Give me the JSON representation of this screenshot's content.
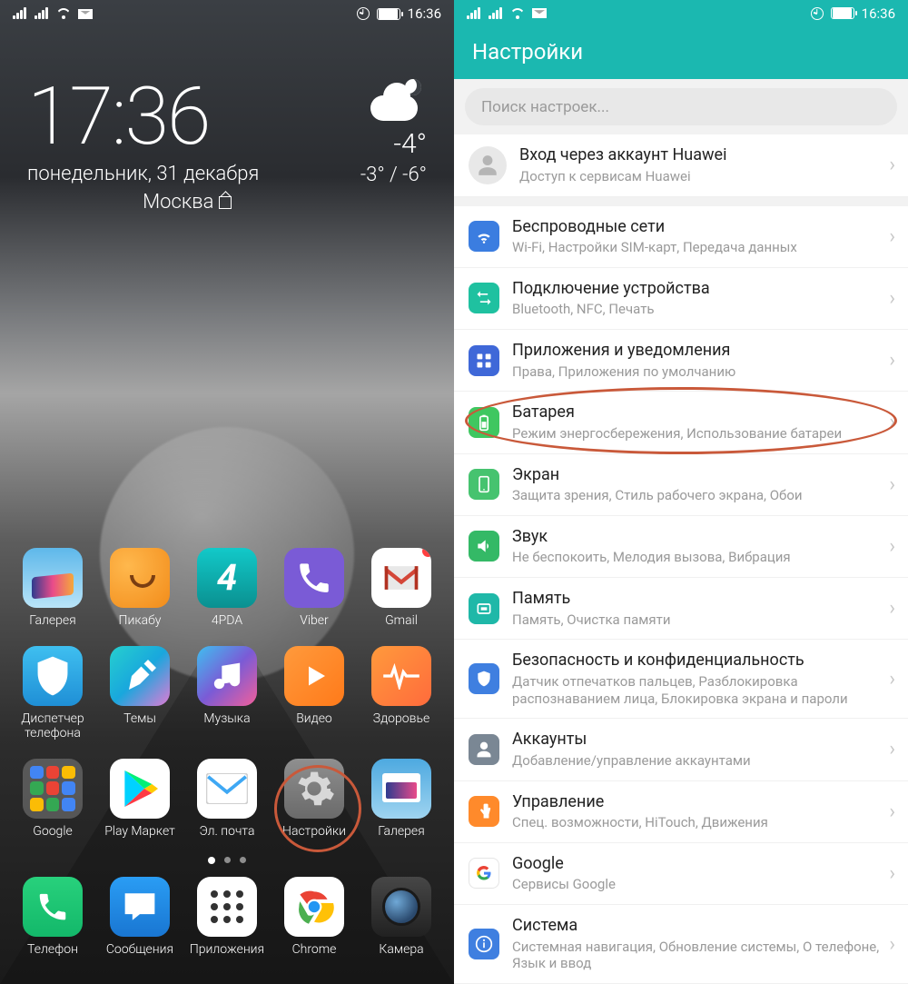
{
  "status": {
    "time": "16:36"
  },
  "home": {
    "clock": "17:36",
    "date": "понедельник, 31 декабря",
    "city": "Москва",
    "temp": "-4°",
    "range": "-3° / -6°",
    "rows": [
      [
        "Галерея",
        "Пикабу",
        "4PDA",
        "Viber",
        "Gmail"
      ],
      [
        "Диспетчер телефона",
        "Темы",
        "Музыка",
        "Видео",
        "Здоровье"
      ],
      [
        "Google",
        "Play Маркет",
        "Эл. почта",
        "Настройки",
        "Галерея"
      ]
    ],
    "dock": [
      "Телефон",
      "Сообщения",
      "Приложения",
      "Chrome",
      "Камера"
    ]
  },
  "settings": {
    "title": "Настройки",
    "search_placeholder": "Поиск настроек...",
    "account": {
      "title": "Вход через аккаунт Huawei",
      "sub": "Доступ к сервисам Huawei"
    },
    "items": [
      {
        "title": "Беспроводные сети",
        "sub": "Wi-Fi, Настройки SIM-карт, Передача данных",
        "color": "c-blue",
        "icon": "wifi"
      },
      {
        "title": "Подключение устройства",
        "sub": "Bluetooth, NFC, Печать",
        "color": "c-teal",
        "icon": "swap"
      },
      {
        "title": "Приложения и уведомления",
        "sub": "Права, Приложения по умолчанию",
        "color": "c-blue2",
        "icon": "grid"
      },
      {
        "title": "Батарея",
        "sub": "Режим энергосбережения, Использование батареи",
        "color": "c-green",
        "icon": "battery",
        "highlight": true
      },
      {
        "title": "Экран",
        "sub": "Защита зрения, Стиль рабочего экрана, Обои",
        "color": "c-green2",
        "icon": "screen"
      },
      {
        "title": "Звук",
        "sub": "Не беспокоить, Мелодия вызова, Вибрация",
        "color": "c-green3",
        "icon": "sound"
      },
      {
        "title": "Память",
        "sub": "Память, Очистка памяти",
        "color": "c-teal2",
        "icon": "memory"
      },
      {
        "title": "Безопасность и конфиденциальность",
        "sub": "Датчик отпечатков пальцев, Разблокировка распознаванием лица, Блокировка экрана и пароли",
        "color": "c-blue3",
        "icon": "shield"
      },
      {
        "title": "Аккаунты",
        "sub": "Добавление/управление аккаунтами",
        "color": "c-grey",
        "icon": "user"
      },
      {
        "title": "Управление",
        "sub": "Спец. возможности, HiTouch, Движения",
        "color": "c-orange",
        "icon": "hand"
      },
      {
        "title": "Google",
        "sub": "Сервисы Google",
        "color": "c-white",
        "icon": "google"
      },
      {
        "title": "Система",
        "sub": "Системная навигация, Обновление системы, О телефоне, Язык и ввод",
        "color": "c-blue4",
        "icon": "info"
      }
    ]
  }
}
